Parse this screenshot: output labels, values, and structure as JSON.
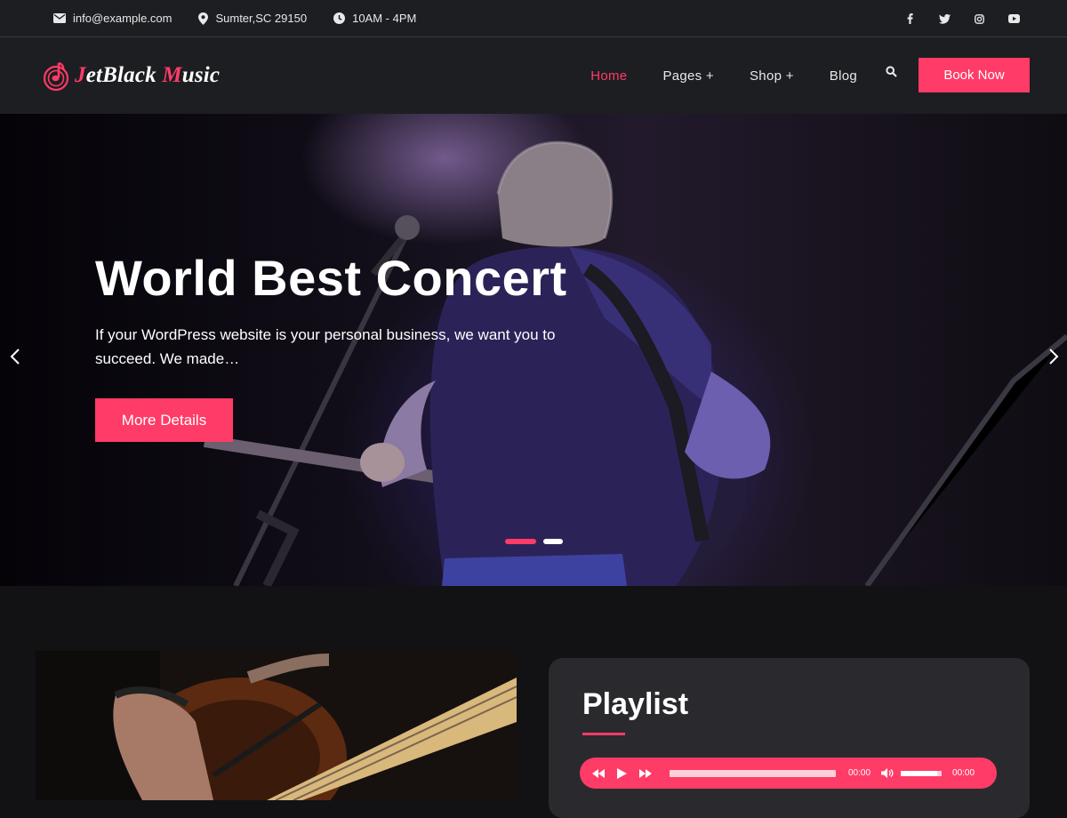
{
  "topbar": {
    "email": "info@example.com",
    "address": "Sumter,SC 29150",
    "hours": "10AM - 4PM",
    "socials": [
      "facebook-icon",
      "twitter-icon",
      "instagram-icon",
      "youtube-icon"
    ]
  },
  "header": {
    "logo_part1": "J",
    "logo_part2": "etBlack ",
    "logo_part3": "M",
    "logo_part4": "usic",
    "nav": [
      {
        "label": "Home",
        "active": true
      },
      {
        "label": "Pages +"
      },
      {
        "label": "Shop +"
      },
      {
        "label": "Blog"
      }
    ],
    "book_label": "Book Now"
  },
  "hero": {
    "title": "World Best Concert",
    "description": "If your WordPress website is your personal business, we want you to succeed. We made…",
    "button_label": "More Details",
    "slides": 2,
    "active_slide": 1
  },
  "playlist": {
    "title": "Playlist",
    "time_current": "00:00",
    "time_total": "00:00",
    "volume": 0.9
  },
  "colors": {
    "accent": "#ff3b67",
    "dark_bg": "#1d1e21",
    "page_bg": "#121214",
    "card_bg": "#2a2a2e"
  }
}
